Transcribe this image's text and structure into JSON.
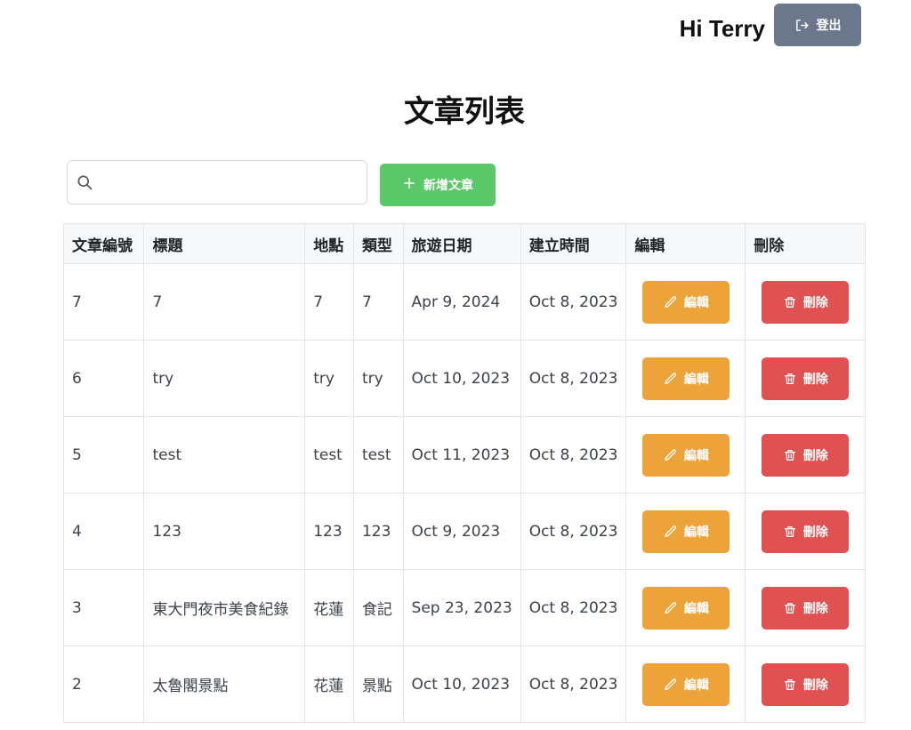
{
  "header": {
    "greeting": "Hi Terry",
    "logout_label": "登出",
    "logout_icon": "logout-icon"
  },
  "page_title": "文章列表",
  "toolbar": {
    "search_placeholder": "",
    "search_icon": "search-icon",
    "add_label": "新增文章",
    "add_icon": "plus-icon"
  },
  "table": {
    "columns": [
      "文章編號",
      "標題",
      "地點",
      "類型",
      "旅遊日期",
      "建立時間",
      "編輯",
      "刪除"
    ],
    "rows": [
      {
        "id": "7",
        "title": "7",
        "location": "7",
        "type": "7",
        "trip_date": "Apr 9, 2024",
        "created": "Oct 8, 2023"
      },
      {
        "id": "6",
        "title": "try",
        "location": "try",
        "type": "try",
        "trip_date": "Oct 10, 2023",
        "created": "Oct 8, 2023"
      },
      {
        "id": "5",
        "title": "test",
        "location": "test",
        "type": "test",
        "trip_date": "Oct 11, 2023",
        "created": "Oct 8, 2023"
      },
      {
        "id": "4",
        "title": "123",
        "location": "123",
        "type": "123",
        "trip_date": "Oct 9, 2023",
        "created": "Oct 8, 2023"
      },
      {
        "id": "3",
        "title": "東大門夜市美食紀錄",
        "location": "花蓮",
        "type": "食記",
        "trip_date": "Sep 23, 2023",
        "created": "Oct 8, 2023"
      },
      {
        "id": "2",
        "title": "太魯閣景點",
        "location": "花蓮",
        "type": "景點",
        "trip_date": "Oct 10, 2023",
        "created": "Oct 8, 2023"
      }
    ],
    "edit_label": "編輯",
    "edit_icon": "pencil-icon",
    "delete_label": "刪除",
    "delete_icon": "trash-icon"
  },
  "colors": {
    "logout_button": "#6b778a",
    "add_button": "#5ac768",
    "edit_button": "#eba33a",
    "delete_button": "#e05252"
  }
}
